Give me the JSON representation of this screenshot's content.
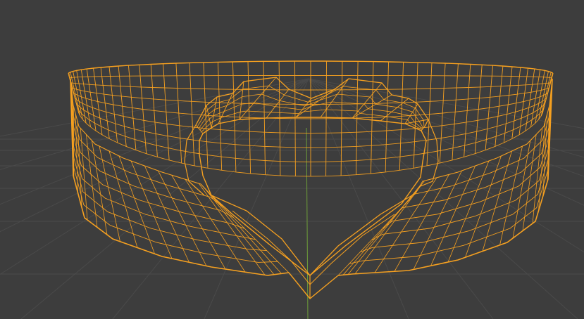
{
  "viewport": {
    "background_color": "#3d3d3d",
    "grid_color": "#4a4a4a",
    "axis_y_color": "#6e9e3a",
    "selection_color": "#f5a020",
    "show_grid": true,
    "show_floor_axis": true
  },
  "object": {
    "type": "heart-shaped ring mesh",
    "display_mode": "wireframe",
    "selected": true
  }
}
